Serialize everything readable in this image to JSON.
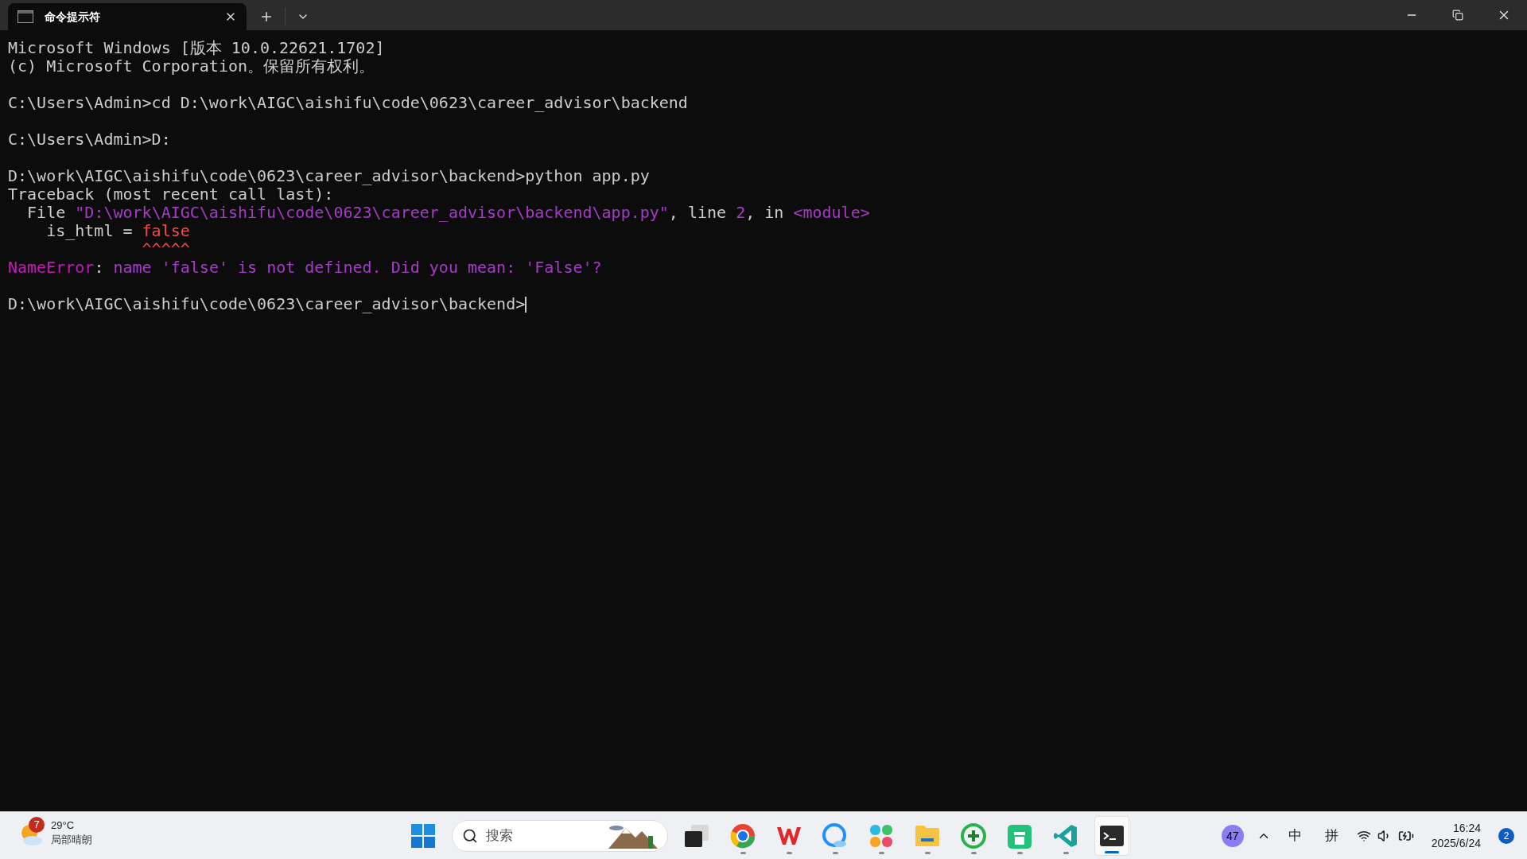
{
  "window": {
    "tabs": [
      {
        "title": "命令提示符",
        "selected": true
      }
    ]
  },
  "terminal": {
    "lines": [
      {
        "kind": "text",
        "segments": [
          {
            "text": "Microsoft Windows [版本 10.0.22621.1702]",
            "kind": "plain"
          }
        ]
      },
      {
        "kind": "text",
        "segments": [
          {
            "text": "(c) Microsoft Corporation。保留所有权利。",
            "kind": "plain"
          }
        ]
      },
      {
        "kind": "blank"
      },
      {
        "kind": "text",
        "segments": [
          {
            "text": "C:\\Users\\Admin>cd D:\\work\\AIGC\\aishifu\\code\\0623\\career_advisor\\backend",
            "kind": "plain"
          }
        ]
      },
      {
        "kind": "blank"
      },
      {
        "kind": "text",
        "segments": [
          {
            "text": "C:\\Users\\Admin>D:",
            "kind": "plain"
          }
        ]
      },
      {
        "kind": "blank"
      },
      {
        "kind": "text",
        "segments": [
          {
            "text": "D:\\work\\AIGC\\aishifu\\code\\0623\\career_advisor\\backend>python app.py",
            "kind": "plain"
          }
        ]
      },
      {
        "kind": "text",
        "segments": [
          {
            "text": "Traceback (most recent call last):",
            "kind": "plain"
          }
        ]
      },
      {
        "kind": "text",
        "segments": [
          {
            "text": "  File ",
            "kind": "plain"
          },
          {
            "text": "\"D:\\work\\AIGC\\aishifu\\code\\0623\\career_advisor\\backend\\app.py\"",
            "kind": "string"
          },
          {
            "text": ", line ",
            "kind": "plain"
          },
          {
            "text": "2",
            "kind": "string"
          },
          {
            "text": ", in ",
            "kind": "plain"
          },
          {
            "text": "<module>",
            "kind": "string"
          }
        ]
      },
      {
        "kind": "text",
        "segments": [
          {
            "text": "    is_html = ",
            "kind": "plain"
          },
          {
            "text": "false",
            "kind": "error"
          }
        ]
      },
      {
        "kind": "text",
        "segments": [
          {
            "text": "              ^^^^^",
            "kind": "error"
          }
        ]
      },
      {
        "kind": "text",
        "segments": [
          {
            "text": "NameError",
            "kind": "errname"
          },
          {
            "text": ": ",
            "kind": "plain"
          },
          {
            "text": "name 'false' is not defined. Did you mean: 'False'?",
            "kind": "string"
          }
        ]
      },
      {
        "kind": "blank"
      },
      {
        "kind": "prompt",
        "segments": [
          {
            "text": "D:\\work\\AIGC\\aishifu\\code\\0623\\career_advisor\\backend>",
            "kind": "plain"
          }
        ]
      }
    ]
  },
  "taskbar": {
    "weather": {
      "badge": "7",
      "temperature": "29°C",
      "condition": "局部晴朗"
    },
    "search": {
      "placeholder": "搜索"
    },
    "apps": [
      {
        "kind": "windows",
        "running": false,
        "selected": false
      },
      {
        "kind": "taskview",
        "running": false,
        "selected": false
      },
      {
        "kind": "browser",
        "running": true,
        "selected": false
      },
      {
        "kind": "office",
        "running": true,
        "selected": false
      },
      {
        "kind": "chat",
        "running": true,
        "selected": false
      },
      {
        "kind": "flower",
        "running": true,
        "selected": false
      },
      {
        "kind": "folder",
        "running": true,
        "selected": false
      },
      {
        "kind": "security",
        "running": true,
        "selected": false
      },
      {
        "kind": "cleaner",
        "running": true,
        "selected": false
      },
      {
        "kind": "editor",
        "running": true,
        "selected": false
      },
      {
        "kind": "terminal",
        "running": true,
        "selected": true
      }
    ],
    "tray": {
      "badge": "47",
      "ime_mode": "中",
      "ime": "拼",
      "time": "16:24",
      "date": "2025/6/24",
      "notifications": "2"
    }
  }
}
